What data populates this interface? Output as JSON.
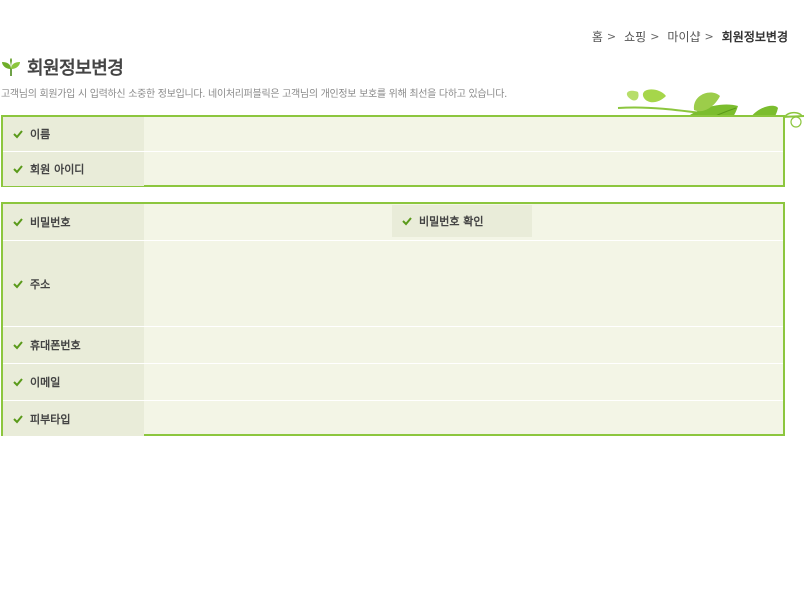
{
  "breadcrumb": {
    "items": [
      "홈",
      "쇼핑",
      "마이샵"
    ],
    "current": "회원정보변경",
    "separator": ">"
  },
  "page": {
    "title": "회원정보변경",
    "subtitle": "고객님의 회원가입 시 입력하신 소중한 정보입니다. 네이처리퍼블릭은 고객님의 개인정보 보호를 위해 최선을 다하고 있습니다."
  },
  "section1": {
    "fields": [
      {
        "label": "이름",
        "value": ""
      },
      {
        "label": "회원 아이디",
        "value": ""
      }
    ]
  },
  "section2": {
    "password_label": "비밀번호",
    "password_value": "",
    "password_confirm_label": "비밀번호 확인",
    "password_confirm_value": "",
    "address_label": "주소",
    "address_value": "",
    "mobile_label": "휴대폰번호",
    "mobile_value": "",
    "email_label": "이메일",
    "email_value": "",
    "skin_label": "피부타입",
    "skin_value": ""
  },
  "colors": {
    "border": "#8cc63e",
    "row_bg": "#f3f5e6",
    "label_bg": "#e9ecd9",
    "check": "#5a9a1a"
  },
  "icons": {
    "title_icon": "leaf-sprout-icon",
    "row_icon": "checkmark-icon",
    "decoration": "leaves-decoration"
  }
}
